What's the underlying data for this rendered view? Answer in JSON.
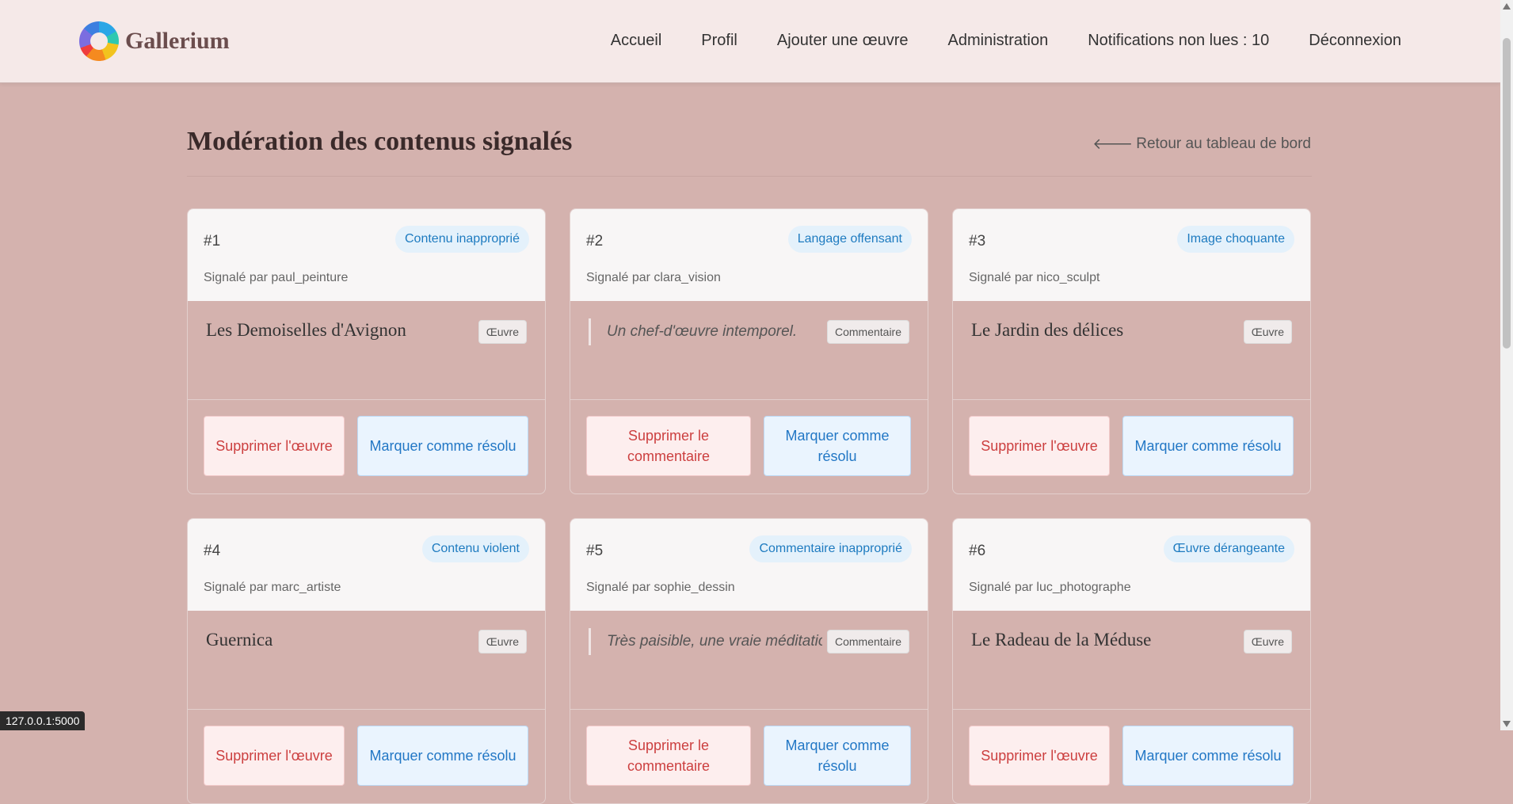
{
  "brand": {
    "name": "Gallerium"
  },
  "nav": {
    "items": [
      "Accueil",
      "Profil",
      "Ajouter une œuvre",
      "Administration",
      "Notifications non lues : 10",
      "Déconnexion"
    ]
  },
  "page": {
    "title": "Modération des contenus signalés",
    "back_link": "Retour au tableau de bord"
  },
  "reports": [
    {
      "id": "#1",
      "reason": "Contenu inapproprié",
      "reporter": "Signalé par paul_peinture",
      "kind": "artwork",
      "content": "Les Demoiselles d'Avignon",
      "type_label": "Œuvre",
      "delete_label": "Supprimer l'œuvre",
      "resolve_label": "Marquer comme résolu"
    },
    {
      "id": "#2",
      "reason": "Langage offensant",
      "reporter": "Signalé par clara_vision",
      "kind": "comment",
      "content": "Un chef-d'œuvre intemporel.",
      "type_label": "Commentaire",
      "delete_label": "Supprimer le commentaire",
      "resolve_label": "Marquer comme résolu"
    },
    {
      "id": "#3",
      "reason": "Image choquante",
      "reporter": "Signalé par nico_sculpt",
      "kind": "artwork",
      "content": "Le Jardin des délices",
      "type_label": "Œuvre",
      "delete_label": "Supprimer l'œuvre",
      "resolve_label": "Marquer comme résolu"
    },
    {
      "id": "#4",
      "reason": "Contenu violent",
      "reporter": "Signalé par marc_artiste",
      "kind": "artwork",
      "content": "Guernica",
      "type_label": "Œuvre",
      "delete_label": "Supprimer l'œuvre",
      "resolve_label": "Marquer comme résolu"
    },
    {
      "id": "#5",
      "reason": "Commentaire inapproprié",
      "reporter": "Signalé par sophie_dessin",
      "kind": "comment",
      "content": "Très paisible, une vraie méditatio",
      "type_label": "Commentaire",
      "delete_label": "Supprimer le commentaire",
      "resolve_label": "Marquer comme résolu"
    },
    {
      "id": "#6",
      "reason": "Œuvre dérangeante",
      "reporter": "Signalé par luc_photographe",
      "kind": "artwork",
      "content": "Le Radeau de la Méduse",
      "type_label": "Œuvre",
      "delete_label": "Supprimer l'œuvre",
      "resolve_label": "Marquer comme résolu"
    }
  ],
  "status_url": "127.0.0.1:5000"
}
